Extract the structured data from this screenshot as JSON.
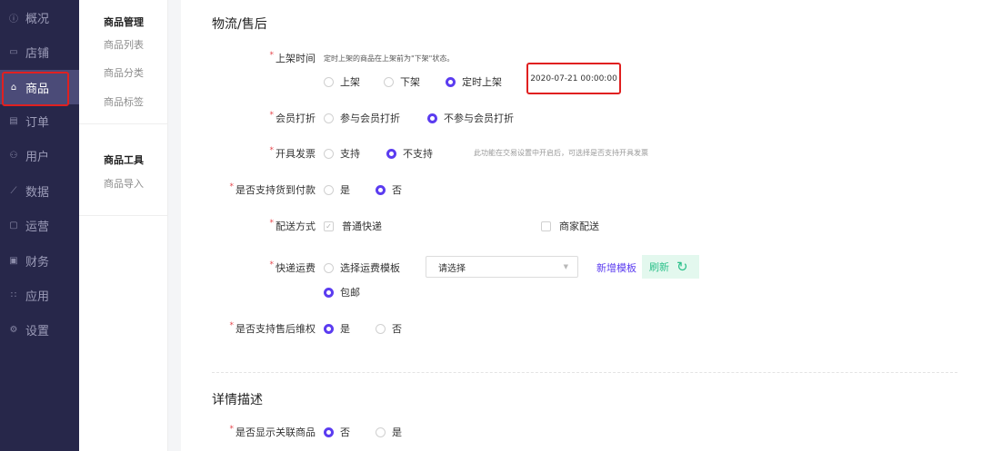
{
  "nav": {
    "items": [
      {
        "label": "概况",
        "icon": "info-icon",
        "active": false
      },
      {
        "label": "店铺",
        "icon": "store-icon",
        "active": false
      },
      {
        "label": "商品",
        "icon": "bag-icon",
        "active": true
      },
      {
        "label": "订单",
        "icon": "order-icon",
        "active": false
      },
      {
        "label": "用户",
        "icon": "user-icon",
        "active": false
      },
      {
        "label": "数据",
        "icon": "chart-icon",
        "active": false
      },
      {
        "label": "运营",
        "icon": "chat-icon",
        "active": false
      },
      {
        "label": "财务",
        "icon": "finance-icon",
        "active": false
      },
      {
        "label": "应用",
        "icon": "apps-icon",
        "active": false
      },
      {
        "label": "设置",
        "icon": "settings-icon",
        "active": false
      }
    ]
  },
  "submenu": {
    "group1_title": "商品管理",
    "group1_items": [
      "商品列表",
      "商品分类",
      "商品标签"
    ],
    "group2_title": "商品工具",
    "group2_items": [
      "商品导入"
    ]
  },
  "logistics": {
    "title": "物流/售后",
    "shelf_time": {
      "label": "上架时间",
      "hint": "定时上架的商品在上架前为\"下架\"状态。",
      "options": [
        "上架",
        "下架",
        "定时上架"
      ],
      "selected": "定时上架",
      "datetime": "2020-07-21 00:00:00"
    },
    "member_discount": {
      "label": "会员打折",
      "options": [
        "参与会员打折",
        "不参与会员打折"
      ],
      "selected": "不参与会员打折"
    },
    "invoice": {
      "label": "开具发票",
      "options": [
        "支持",
        "不支持"
      ],
      "selected": "不支持",
      "hint": "此功能在交易设置中开启后，可选择是否支持开具发票"
    },
    "cod": {
      "label": "是否支持货到付款",
      "options": [
        "是",
        "否"
      ],
      "selected": "否"
    },
    "delivery": {
      "label": "配送方式",
      "options": [
        "普通快递",
        "商家配送"
      ]
    },
    "shipping_fee": {
      "label": "快递运费",
      "template_option": "选择运费模板",
      "select_placeholder": "请选择",
      "new_template": "新增模板",
      "refresh": "刷新",
      "free_option": "包邮",
      "selected": "包邮"
    },
    "after_sale": {
      "label": "是否支持售后维权",
      "options": [
        "是",
        "否"
      ],
      "selected": "是"
    }
  },
  "detail": {
    "title": "详情描述",
    "related": {
      "label": "是否显示关联商品",
      "options": [
        "否",
        "是"
      ],
      "selected": "否"
    }
  },
  "colors": {
    "nav_bg": "#27274a",
    "accent": "#5b3cf0",
    "highlight_border": "#e02020",
    "refresh_green": "#2bc08a"
  }
}
